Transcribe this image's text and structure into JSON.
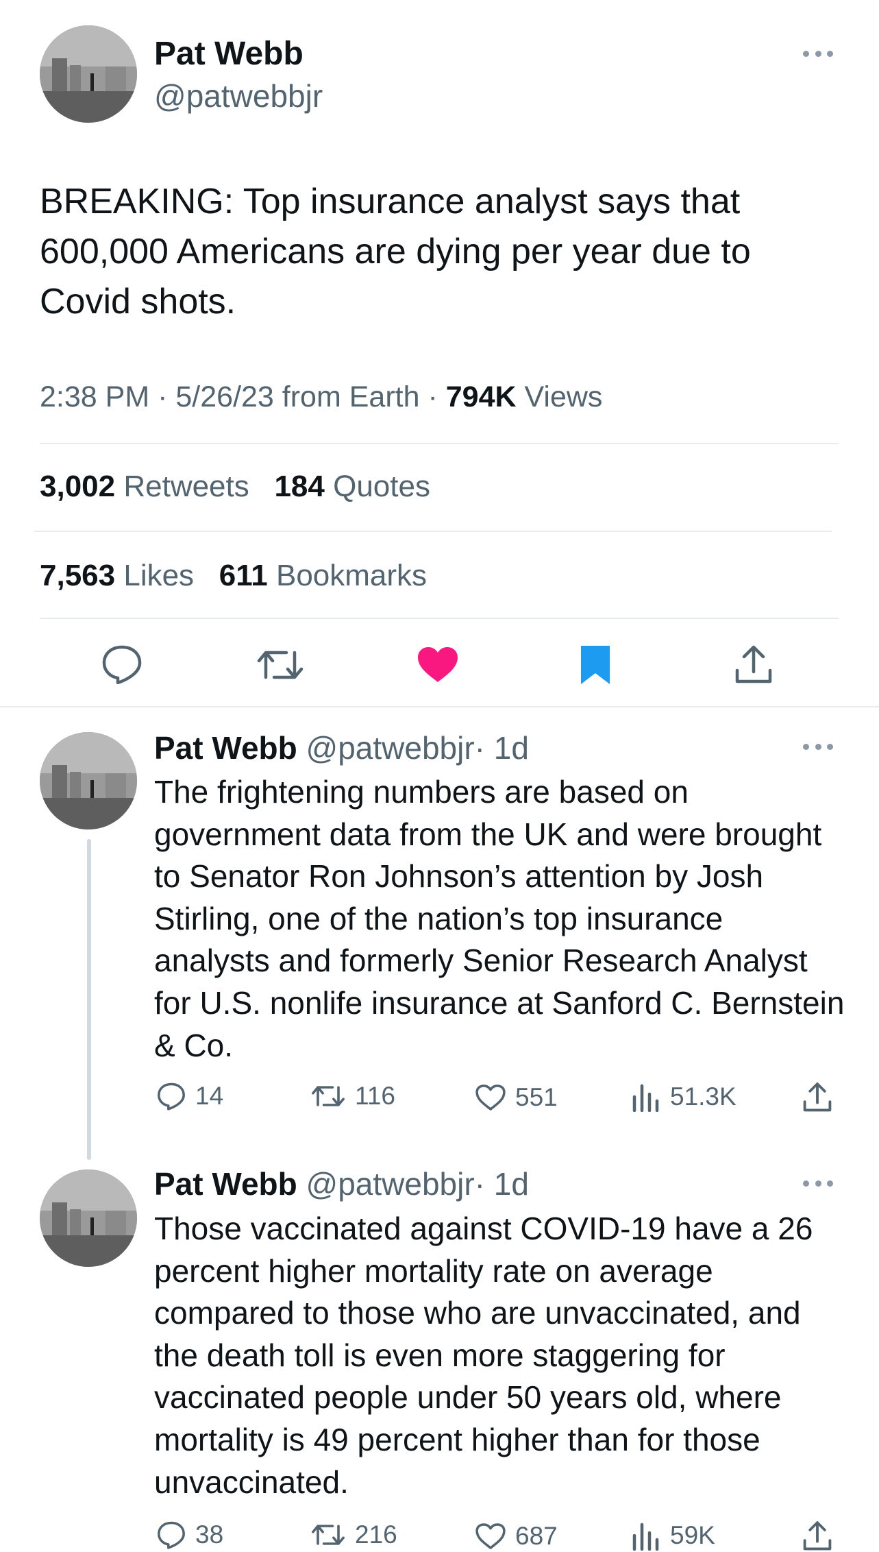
{
  "main_tweet": {
    "author_name": "Pat Webb",
    "author_handle": "@patwebbjr",
    "text": "BREAKING: Top insurance analyst says that 600,000 Americans are dying per year due to Covid shots.",
    "time": "2:38 PM",
    "separator": "·",
    "date_source": "5/26/23 from Earth",
    "views_count": "794K",
    "views_label": "Views",
    "retweets_count": "3,002",
    "retweets_label": "Retweets",
    "quotes_count": "184",
    "quotes_label": "Quotes",
    "likes_count": "7,563",
    "likes_label": "Likes",
    "bookmarks_count": "611",
    "bookmarks_label": "Bookmarks",
    "actions": [
      "reply-icon",
      "retweet-icon",
      "like-icon-filled",
      "bookmark-icon-filled",
      "share-icon"
    ]
  },
  "replies": [
    {
      "author_name": "Pat Webb",
      "author_handle": "@patwebbjr",
      "age": "· 1d",
      "text": "The frightening numbers are based on government data from the UK and were brought to Senator Ron Johnson’s attention by Josh Stirling, one of the nation’s top insurance analysts and formerly Senior Research Analyst for U.S. nonlife insurance at Sanford C. Bernstein & Co.",
      "replies": "14",
      "retweets": "116",
      "likes": "551",
      "views": "51.3K"
    },
    {
      "author_name": "Pat Webb",
      "author_handle": "@patwebbjr",
      "age": "· 1d",
      "text": "Those vaccinated against COVID-19 have a 26 percent higher mortality rate on average compared to those who are unvaccinated, and the death toll is even more staggering for vaccinated people under 50 years old, where mortality is 49 percent higher than for those unvaccinated.",
      "replies": "38",
      "retweets": "216",
      "likes": "687",
      "views": "59K"
    }
  ],
  "colors": {
    "text": "#0f1419",
    "secondary": "#536471",
    "like_pink": "#f91880",
    "bookmark_blue": "#1d9bf0",
    "divider": "#e6ecf0"
  }
}
